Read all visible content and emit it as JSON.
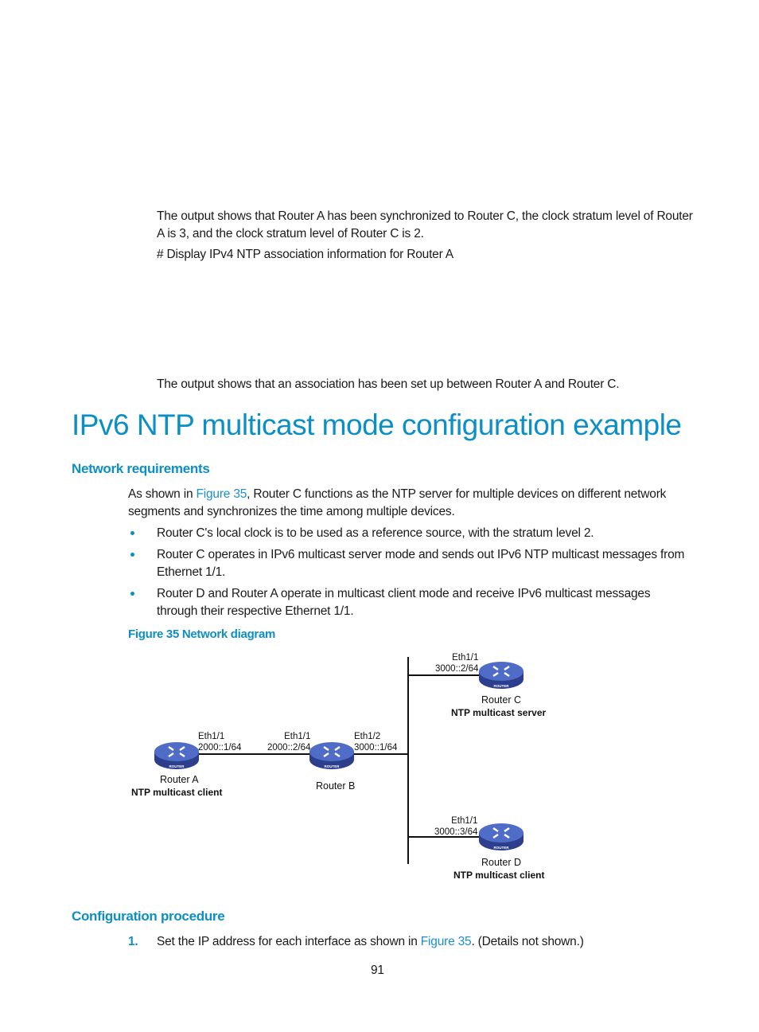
{
  "top": {
    "para1": "The output shows that Router A has been synchronized to Router C, the clock stratum level of Router",
    "para1_line2": "A is 3, and the clock stratum level of Router C is 2.",
    "para2": "# Display IPv4 NTP association information for Router A",
    "para3": "The output shows that an association has been set up between Router A and Router C."
  },
  "section": {
    "title": "IPv6 NTP multicast mode configuration example",
    "network_requirements": {
      "heading": "Network requirements",
      "intro_prefix": "As shown in ",
      "intro_link": "Figure 35",
      "intro_suffix": ", Router C functions as the NTP server for multiple devices on different network",
      "intro_line2": "segments and synchronizes the time among multiple devices.",
      "bullets": [
        {
          "line1": "Router C's local clock is to be used as a reference source, with the stratum level 2.",
          "line2": ""
        },
        {
          "line1": "Router C operates in IPv6 multicast server mode and sends out IPv6 NTP multicast messages from",
          "line2": "Ethernet 1/1."
        },
        {
          "line1": "Router D and Router A operate in multicast client mode and receive IPv6 multicast messages",
          "line2": "through their respective Ethernet 1/1."
        }
      ]
    },
    "figure": {
      "caption": "Figure 35 Network diagram",
      "router_badge": "ROUTER",
      "routers": {
        "a": {
          "name": "Router A",
          "role": "NTP multicast client",
          "if_name": "Eth1/1",
          "if_addr": "2000::1/64"
        },
        "b": {
          "name": "Router B",
          "if1_name": "Eth1/1",
          "if1_addr": "2000::2/64",
          "if2_name": "Eth1/2",
          "if2_addr": "3000::1/64"
        },
        "c": {
          "name": "Router C",
          "role": "NTP multicast server",
          "if_name": "Eth1/1",
          "if_addr": "3000::2/64"
        },
        "d": {
          "name": "Router D",
          "role": "NTP multicast client",
          "if_name": "Eth1/1",
          "if_addr": "3000::3/64"
        }
      }
    },
    "configuration_procedure": {
      "heading": "Configuration procedure",
      "steps": [
        {
          "number": "1.",
          "prefix": "Set the IP address for each interface as shown in ",
          "link": "Figure 35",
          "suffix": ". (Details not shown.)"
        }
      ]
    }
  },
  "footer": {
    "page_number": "91"
  }
}
